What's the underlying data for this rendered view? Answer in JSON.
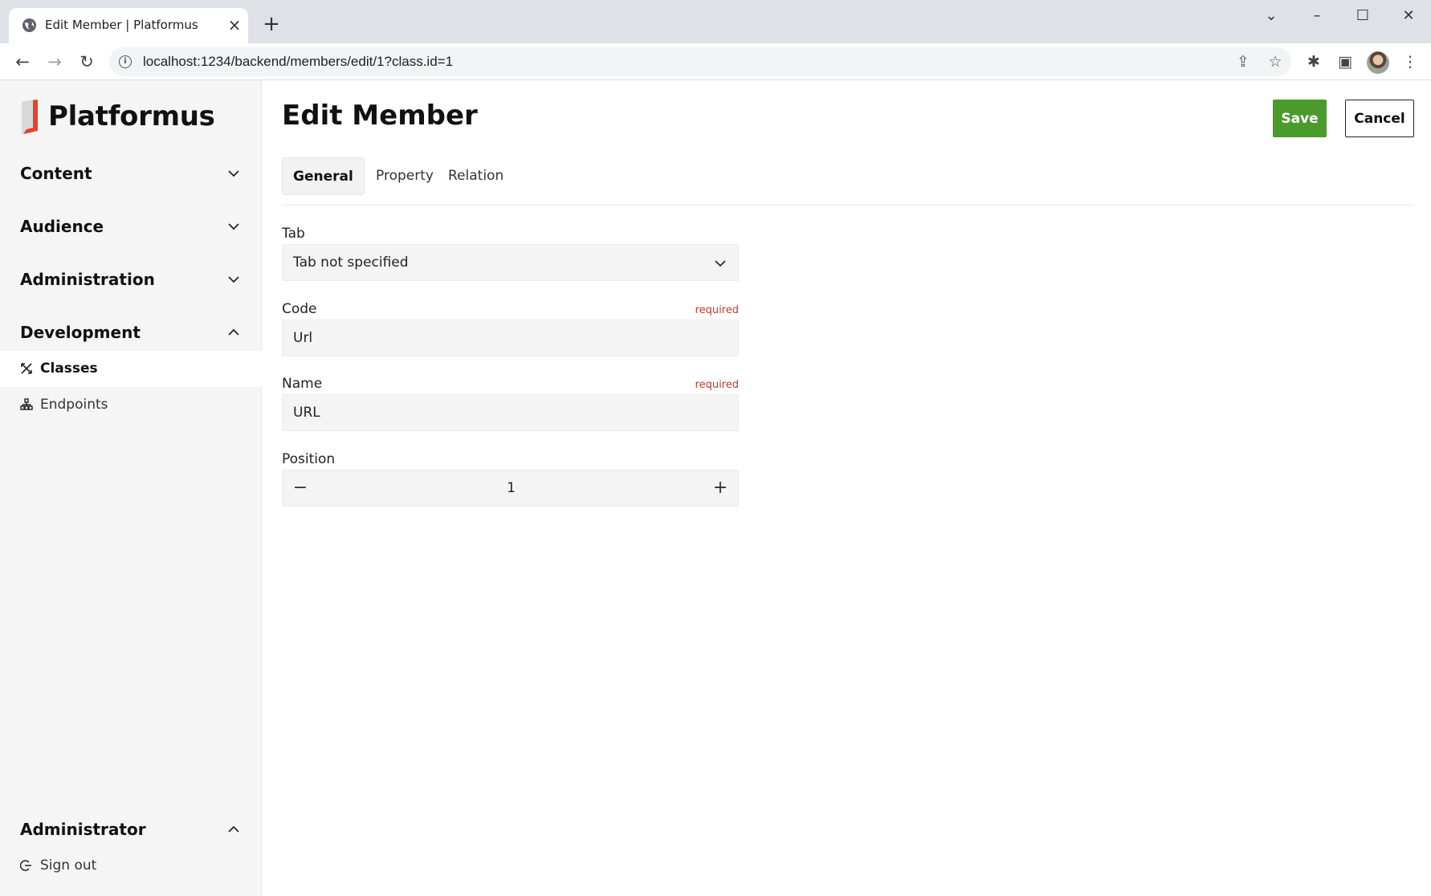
{
  "browser": {
    "tab_title": "Edit Member | Platformus",
    "url": "localhost:1234/backend/members/edit/1?class.id=1"
  },
  "sidebar": {
    "logo_text": "Platformus",
    "sections": [
      {
        "label": "Content",
        "expanded": false
      },
      {
        "label": "Audience",
        "expanded": false
      },
      {
        "label": "Administration",
        "expanded": false
      },
      {
        "label": "Development",
        "expanded": true
      }
    ],
    "development_items": [
      {
        "label": "Classes",
        "icon": "classes-icon",
        "active": true
      },
      {
        "label": "Endpoints",
        "icon": "endpoints-icon",
        "active": false
      }
    ],
    "user_section": {
      "label": "Administrator",
      "expanded": true
    },
    "user_items": [
      {
        "label": "Sign out",
        "icon": "sign-out-icon"
      }
    ]
  },
  "page": {
    "title": "Edit Member",
    "save_label": "Save",
    "cancel_label": "Cancel",
    "tabs": [
      {
        "label": "General",
        "active": true
      },
      {
        "label": "Property",
        "active": false
      },
      {
        "label": "Relation",
        "active": false
      }
    ]
  },
  "form": {
    "tab": {
      "label": "Tab",
      "value": "Tab not specified"
    },
    "code": {
      "label": "Code",
      "value": "Url",
      "required_label": "required"
    },
    "name": {
      "label": "Name",
      "value": "URL",
      "required_label": "required"
    },
    "position": {
      "label": "Position",
      "value": "1"
    }
  },
  "colors": {
    "save_button": "#4a9a2c",
    "required_text": "#c0392b",
    "logo_accent": "#e8412c"
  }
}
